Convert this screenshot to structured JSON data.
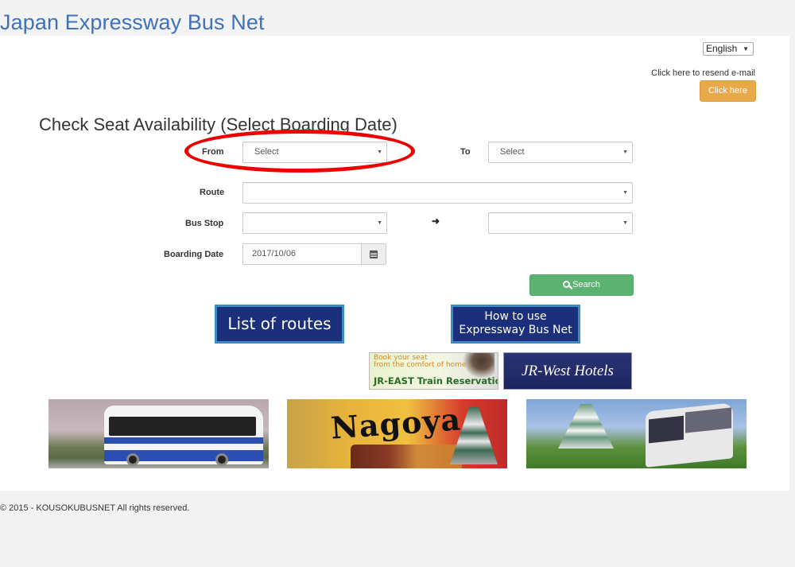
{
  "header": {
    "site_title": "Japan Expressway Bus Net"
  },
  "language": {
    "selected": "English",
    "arrow_icon": "▼"
  },
  "resend": {
    "text": "Click here to resend e-mail",
    "button_label": "Click here",
    "button_color": "#e8a94a"
  },
  "form": {
    "title": "Check Seat Availability (Select Boarding Date)",
    "from": {
      "label": "From",
      "value": "Select"
    },
    "to": {
      "label": "To",
      "value": "Select"
    },
    "route": {
      "label": "Route",
      "value": ""
    },
    "bus_stop": {
      "label": "Bus Stop",
      "from_value": "",
      "to_value": "",
      "arrow_icon": "➜"
    },
    "boarding_date": {
      "label": "Boarding Date",
      "value": "2017/10/06",
      "calendar_icon": "calendar-icon"
    },
    "search_button": {
      "label": "Search",
      "icon": "search-icon",
      "color": "#5cb270"
    },
    "dropdown_arrow": "▼"
  },
  "annotation": {
    "highlight_color": "#ee0000",
    "highlights": "from-select"
  },
  "links": {
    "list_of_routes": "List of routes",
    "how_to_use_line1": "How to use",
    "how_to_use_line2": "Expressway Bus Net"
  },
  "banners": {
    "jr_east_sub_line1": "Book your seat",
    "jr_east_sub_line2": "from the comfort of home",
    "jr_east_main": "JR-EAST Train Reservation",
    "jr_west": "JR-West Hotels"
  },
  "photos": {
    "nagoya_text": "Nagoya"
  },
  "footer": {
    "copyright": "© 2015 - KOUSOKUBUSNET All rights reserved."
  }
}
